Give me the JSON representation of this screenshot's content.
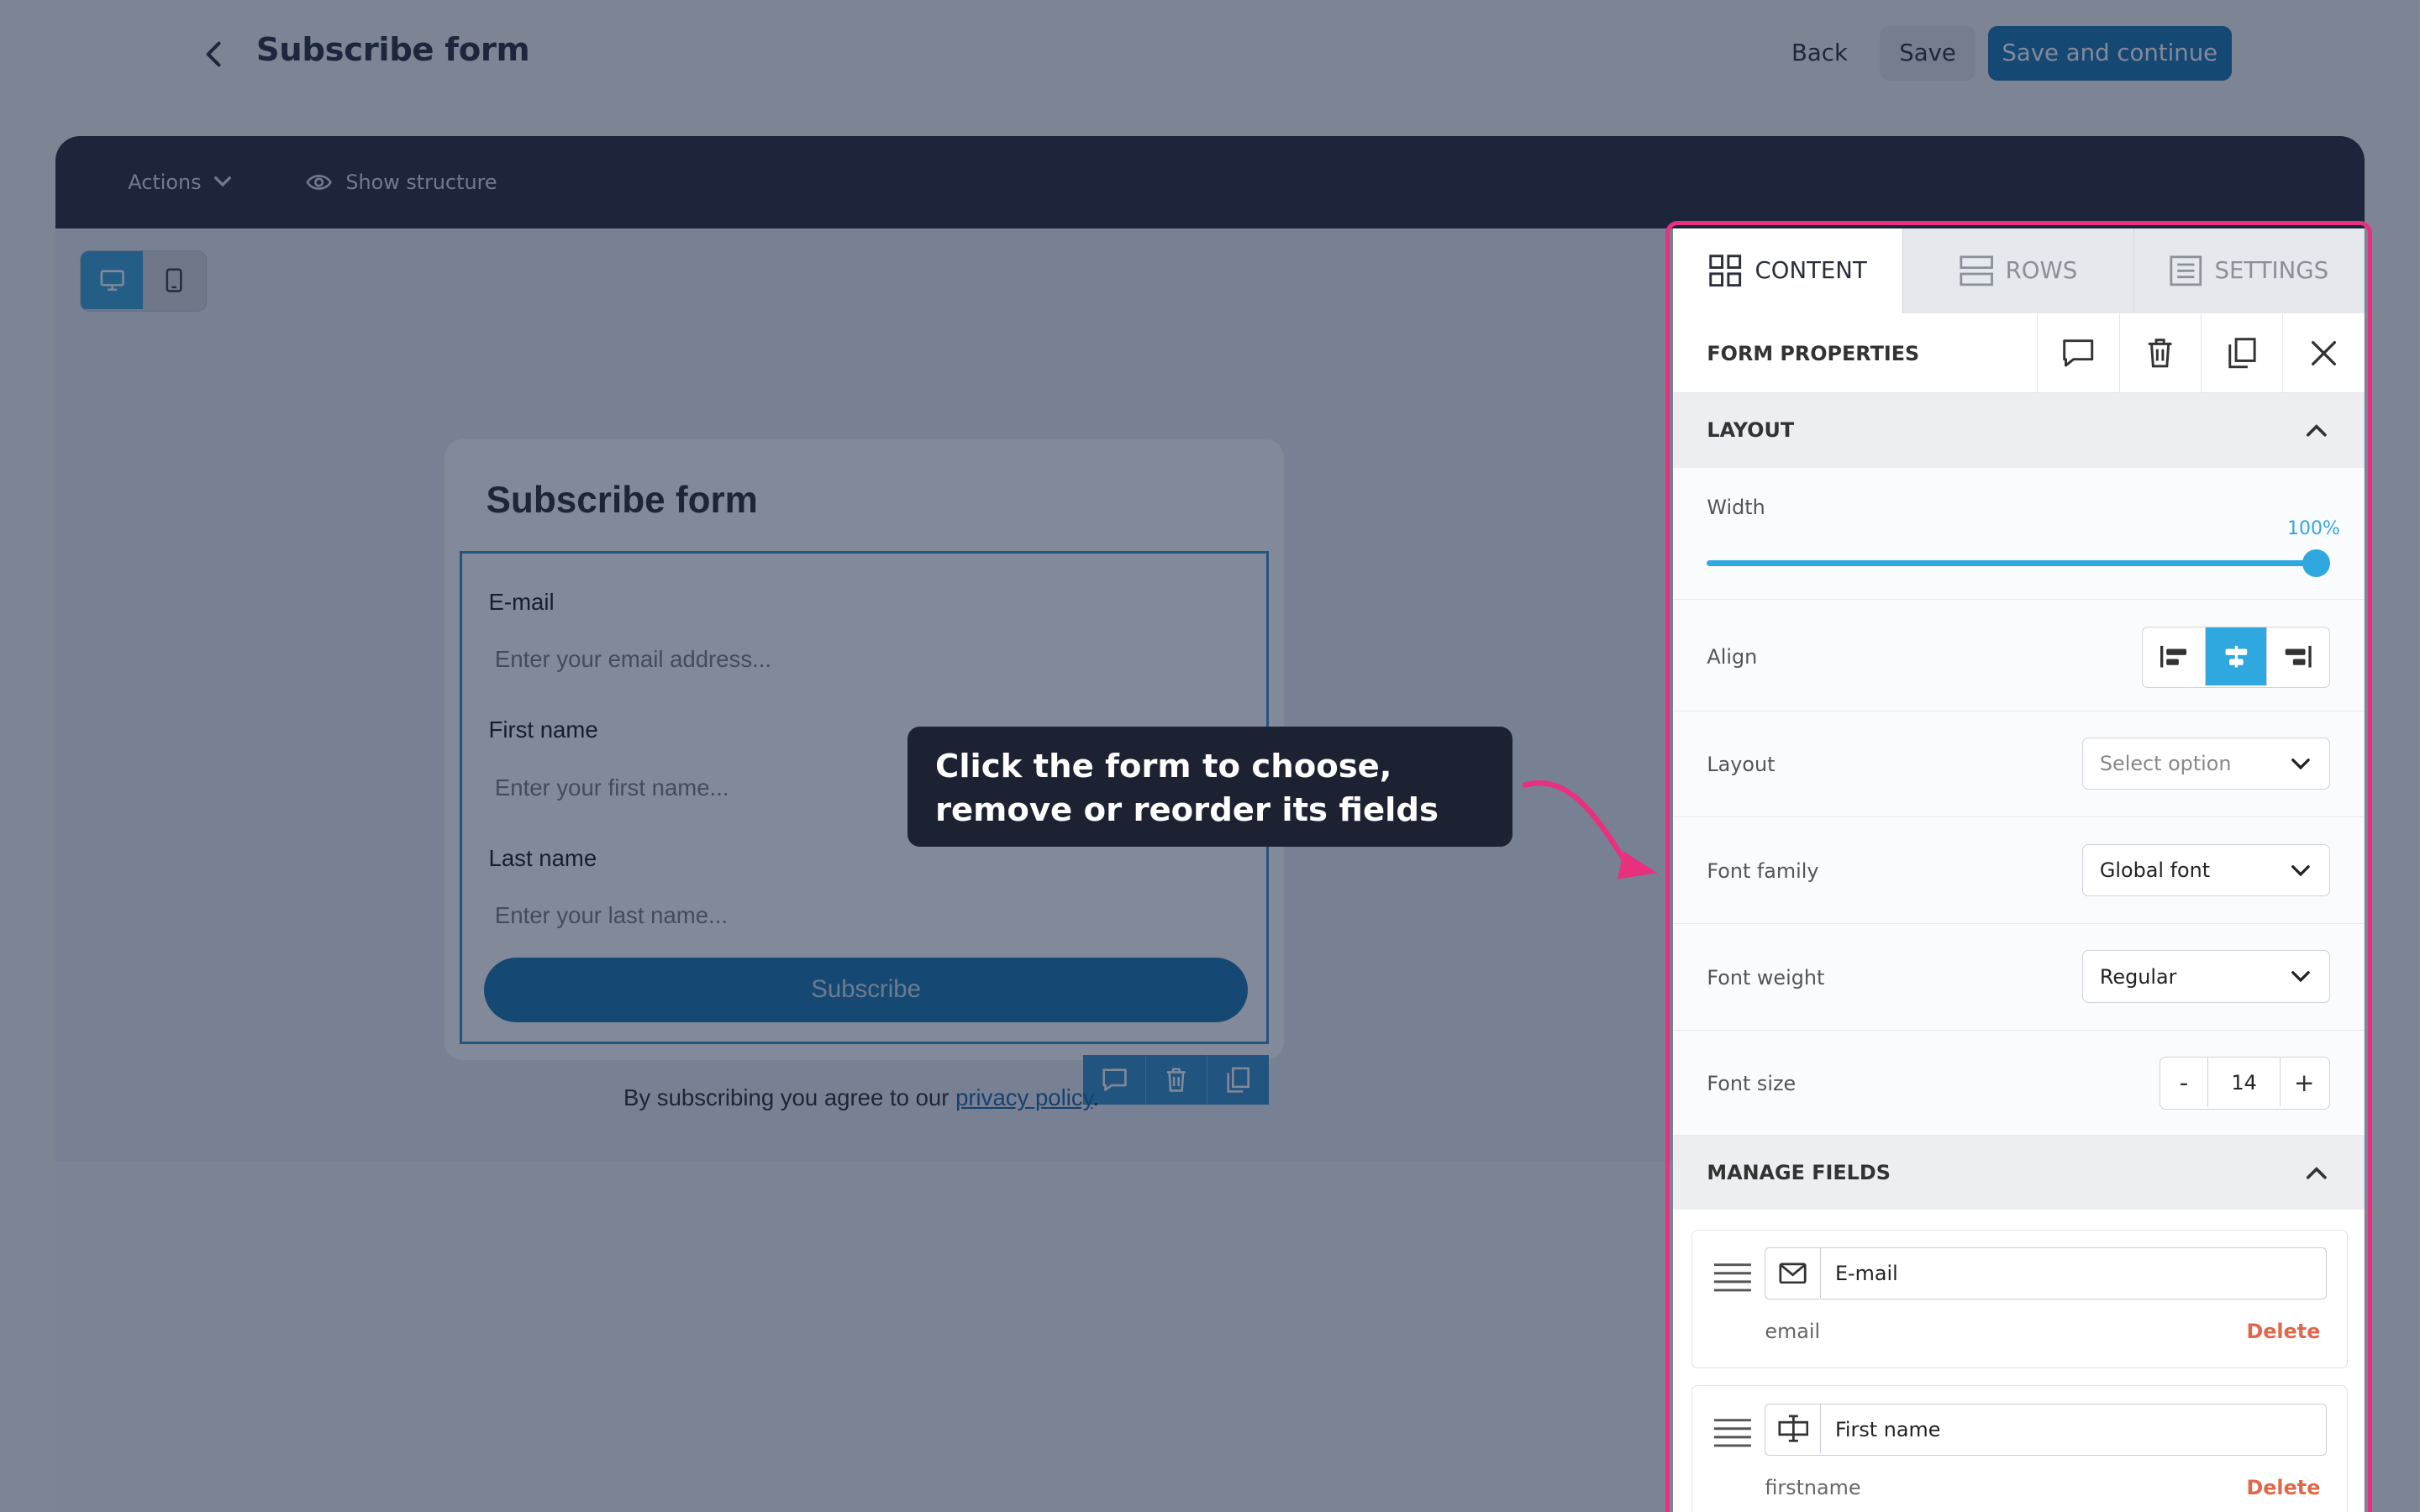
{
  "header": {
    "title": "Subscribe form",
    "back_label": "Back",
    "save_label": "Save",
    "save_continue_label": "Save and continue"
  },
  "toolbar": {
    "actions_label": "Actions",
    "show_structure_label": "Show structure"
  },
  "device_toggle": {
    "active": "desktop"
  },
  "form": {
    "heading": "Subscribe form",
    "fields": [
      {
        "label": "E-mail",
        "placeholder": "Enter your email address..."
      },
      {
        "label": "First name",
        "placeholder": "Enter your first name..."
      },
      {
        "label": "Last name",
        "placeholder": "Enter your last name..."
      }
    ],
    "submit_label": "Subscribe",
    "consent_text": "By subscribing you agree to our ",
    "consent_link": "privacy policy",
    "consent_end": "."
  },
  "tooltip": {
    "text": "Click the form to choose, remove or reorder its fields"
  },
  "panel": {
    "tabs": [
      "CONTENT",
      "ROWS",
      "SETTINGS"
    ],
    "active_tab": "CONTENT",
    "properties_title": "FORM PROPERTIES",
    "layout_section": "LAYOUT",
    "width_label": "Width",
    "width_value": "100%",
    "width_fraction": 1.0,
    "align_label": "Align",
    "align_active": "center",
    "layout_label": "Layout",
    "layout_placeholder": "Select option",
    "font_family_label": "Font family",
    "font_family_value": "Global font",
    "font_weight_label": "Font weight",
    "font_weight_value": "Regular",
    "font_size_label": "Font size",
    "font_size_value": "14",
    "minus": "-",
    "plus": "+",
    "manage_section": "MANAGE FIELDS",
    "fields": [
      {
        "name": "E-mail",
        "key": "email",
        "delete": "Delete",
        "icon": "envelope-icon"
      },
      {
        "name": "First name",
        "key": "firstname",
        "delete": "Delete",
        "icon": "text-cursor-icon"
      }
    ]
  },
  "colors": {
    "accent": "#2fa8e0",
    "primary_button": "#0f6fae",
    "highlight_outline": "#e8307f",
    "delete_text": "#e0684a"
  }
}
